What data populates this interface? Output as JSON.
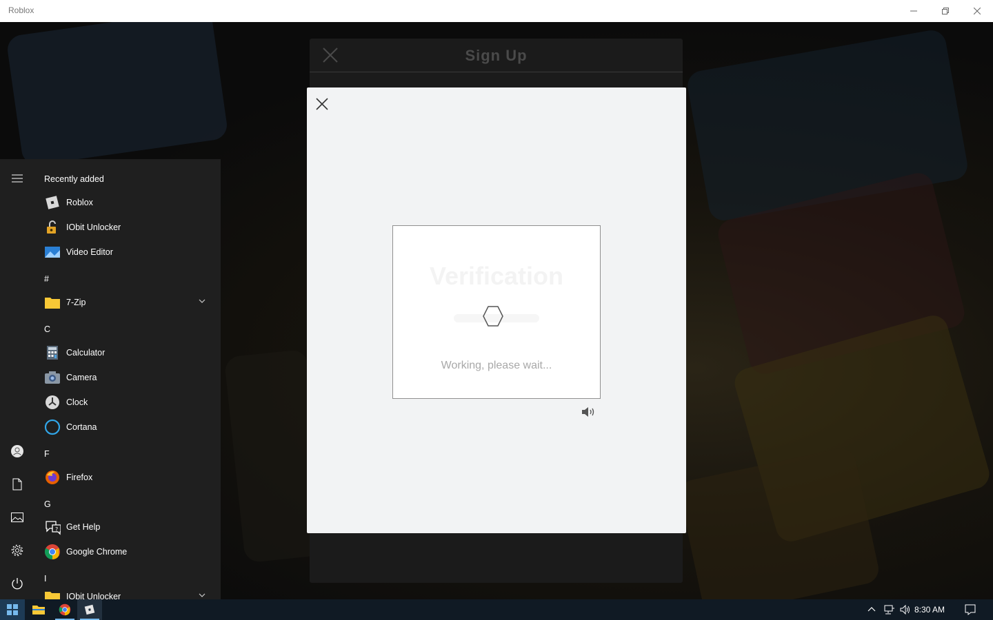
{
  "window": {
    "title": "Roblox"
  },
  "signup": {
    "title": "Sign Up"
  },
  "captcha": {
    "heading": "Verification",
    "status": "Working, please wait..."
  },
  "start_menu": {
    "recent_header": "Recently added",
    "items": [
      {
        "label": "Roblox",
        "icon": "roblox-icon"
      },
      {
        "label": "IObit Unlocker",
        "icon": "iobit-unlocker-icon"
      },
      {
        "label": "Video Editor",
        "icon": "video-editor-icon"
      },
      {
        "section": "#"
      },
      {
        "label": "7-Zip",
        "icon": "folder-icon",
        "expandable": true
      },
      {
        "section": "C"
      },
      {
        "label": "Calculator",
        "icon": "calculator-icon"
      },
      {
        "label": "Camera",
        "icon": "camera-icon"
      },
      {
        "label": "Clock",
        "icon": "clock-icon"
      },
      {
        "label": "Cortana",
        "icon": "cortana-icon"
      },
      {
        "section": "F"
      },
      {
        "label": "Firefox",
        "icon": "firefox-icon"
      },
      {
        "section": "G"
      },
      {
        "label": "Get Help",
        "icon": "get-help-icon"
      },
      {
        "label": "Google Chrome",
        "icon": "chrome-icon"
      },
      {
        "section": "I"
      },
      {
        "label": "IObit Unlocker",
        "icon": "folder-icon",
        "expandable": true
      }
    ]
  },
  "taskbar": {
    "time": "8:30 AM"
  },
  "colors": {
    "accent": "#76b9ed",
    "taskbar": "#101a24",
    "modal": "#f2f3f4"
  }
}
